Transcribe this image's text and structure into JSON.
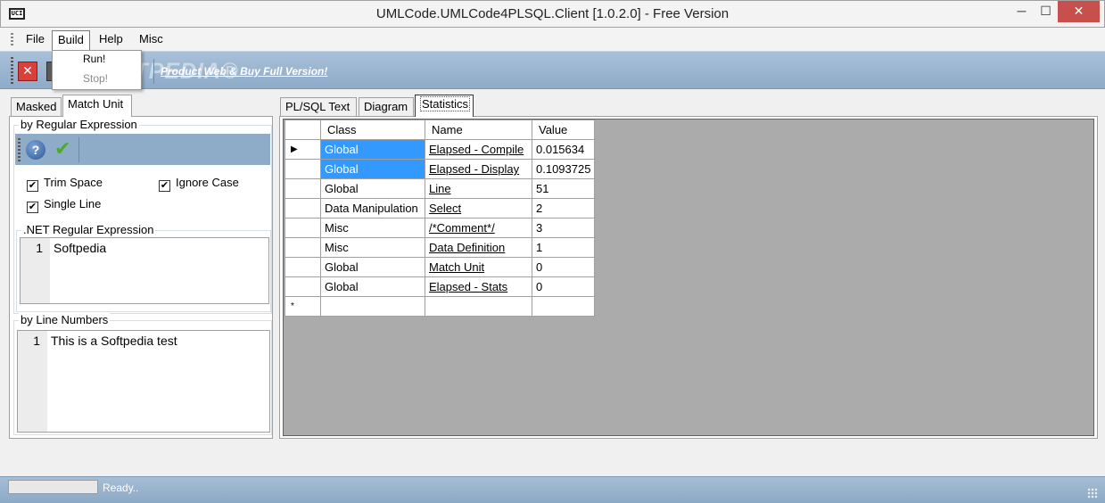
{
  "window": {
    "icon_label": "UCI",
    "title": "UMLCode.UMLCode4PLSQL.Client [1.0.2.0] - Free Version",
    "min_glyph": "─",
    "max_glyph": "☐",
    "close_glyph": "✕"
  },
  "menu": {
    "file": "File",
    "build": "Build",
    "help": "Help",
    "misc": "Misc"
  },
  "build_menu": {
    "run": "Run!",
    "stop": "Stop!"
  },
  "toolbar": {
    "close_glyph": "✕",
    "link": "Product Web & Buy Full Version!",
    "watermark": "SOFTPEDIA®"
  },
  "left_tabs": {
    "masked": "Masked",
    "match_unit": "Match Unit"
  },
  "regex_group": {
    "legend": "by Regular Expression",
    "help_glyph": "?",
    "apply_glyph": "✔",
    "trim_space": {
      "label": "Trim Space",
      "checked": "✔"
    },
    "ignore_case": {
      "label": "Ignore Case",
      "checked": "✔"
    },
    "single_line": {
      "label": "Single Line",
      "checked": "✔"
    },
    "net_legend": ".NET Regular Expression",
    "editor_line_no": "1",
    "editor_text": "Softpedia"
  },
  "line_group": {
    "legend": "by Line Numbers",
    "editor_line_no": "1",
    "editor_text": "This is a Softpedia test"
  },
  "right_tabs": {
    "plsql": "PL/SQL Text",
    "diagram": "Diagram",
    "statistics": "Statistics"
  },
  "grid": {
    "columns": [
      "Class",
      "Name",
      "Value"
    ],
    "current_row_marker": "▶",
    "new_row_marker": "*",
    "rows": [
      {
        "class": "Global",
        "name": "Elapsed - Compile",
        "value": "0.015634"
      },
      {
        "class": "Global",
        "name": "Elapsed - Display",
        "value": "0.1093725"
      },
      {
        "class": "Global",
        "name": "Line",
        "value": "51"
      },
      {
        "class": "Data Manipulation",
        "name": "Select",
        "value": "2"
      },
      {
        "class": "Misc",
        "name": "/*Comment*/",
        "value": "3"
      },
      {
        "class": "Misc",
        "name": "Data Definition",
        "value": "1"
      },
      {
        "class": "Global",
        "name": "Match Unit",
        "value": "0"
      },
      {
        "class": "Global",
        "name": "Elapsed - Stats",
        "value": "0"
      }
    ]
  },
  "status": {
    "text": "Ready.."
  },
  "colors": {
    "toolbar_blue": "#8eabc8",
    "selection": "#3399ff",
    "close_red": "#c7504c"
  }
}
